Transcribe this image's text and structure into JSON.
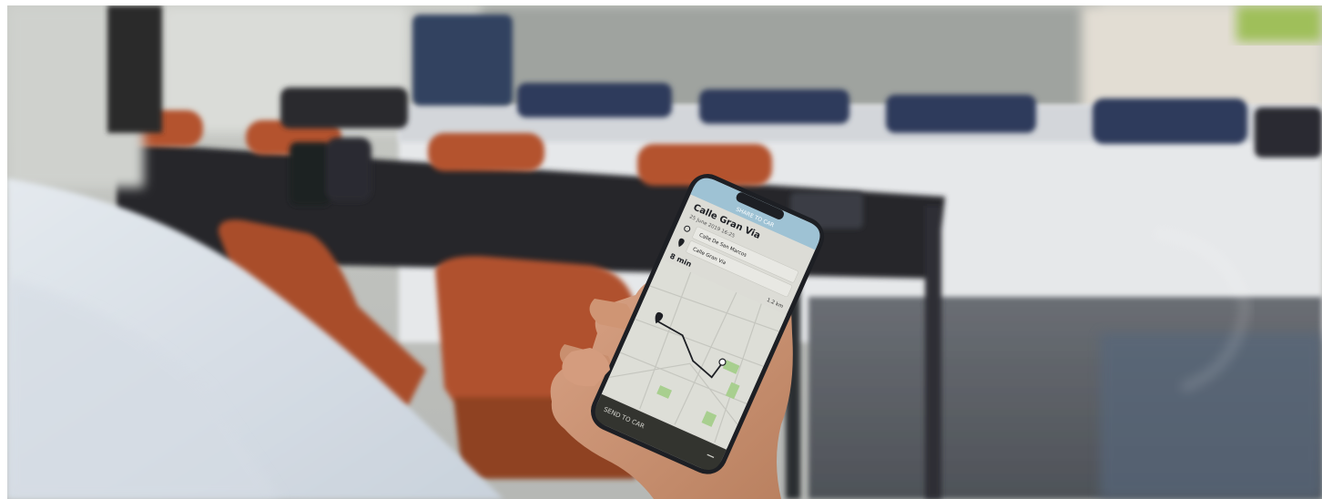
{
  "phone": {
    "header": "SHARE TO CAR",
    "title": "Calle Gran Via",
    "datetime": "25 June 2019 16:25",
    "origin": "Calle De San Marcos",
    "destination": "Calle Gran Via",
    "duration": "8 min",
    "distance": "1.2 km",
    "send_button": "SEND TO CAR"
  },
  "colors": {
    "header_blue": "#9ec2d4",
    "button_dark": "#33342f",
    "chair_orange": "#b4532e",
    "map_bg": "#ddded7"
  }
}
